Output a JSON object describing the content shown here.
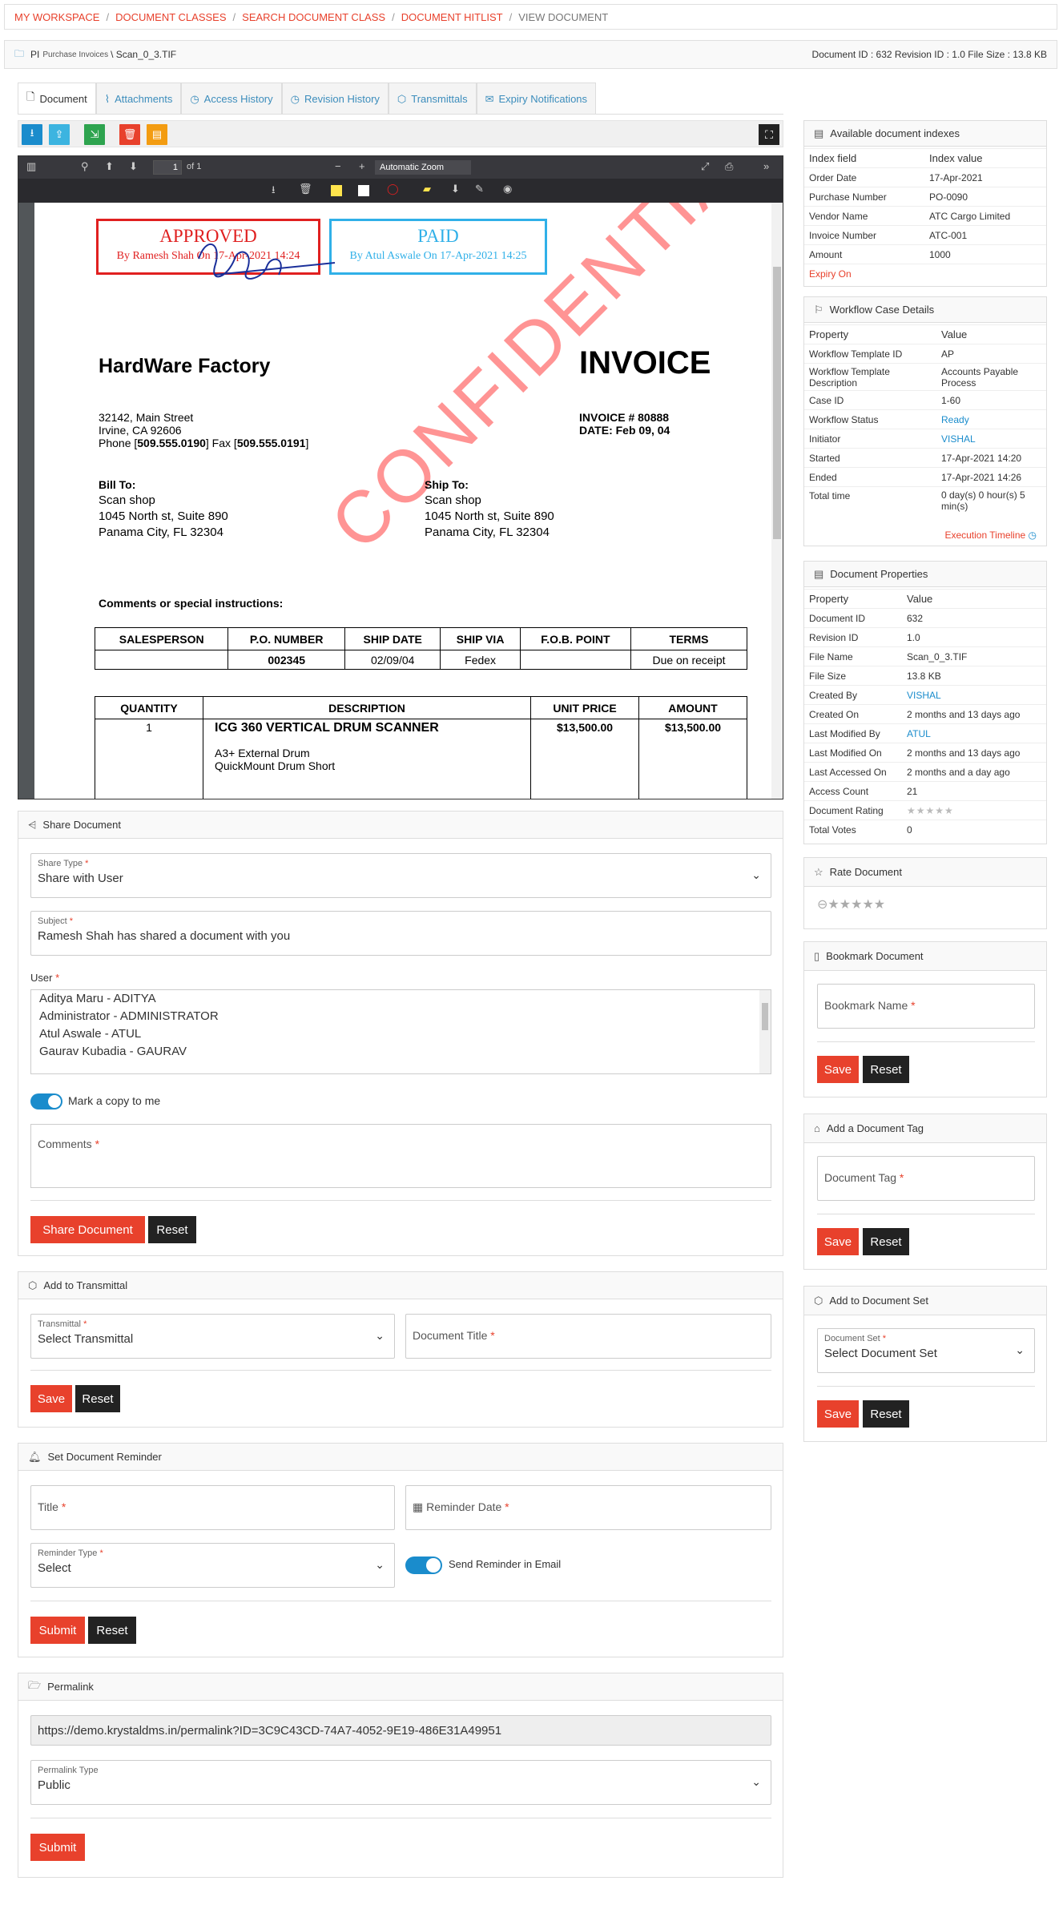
{
  "breadcrumb": {
    "items": [
      "MY WORKSPACE",
      "DOCUMENT CLASSES",
      "SEARCH DOCUMENT CLASS",
      "DOCUMENT HITLIST"
    ],
    "current": "VIEW DOCUMENT"
  },
  "docbar": {
    "class_code": "PI",
    "class_name": "Purchase Invoices",
    "file": "\\ Scan_0_3.TIF",
    "info": "Document ID : 632  Revision ID : 1.0  File Size : 13.8 KB"
  },
  "tabs": [
    {
      "label": "Document",
      "icon": "file-icon"
    },
    {
      "label": "Attachments",
      "icon": "paperclip-icon"
    },
    {
      "label": "Access History",
      "icon": "clock-icon"
    },
    {
      "label": "Revision History",
      "icon": "clock-icon"
    },
    {
      "label": "Transmittals",
      "icon": "cube-icon"
    },
    {
      "label": "Expiry Notifications",
      "icon": "envelope-icon"
    }
  ],
  "toolbar": {
    "colors": [
      "#1a8ccc",
      "#3cb4e0",
      "#2ea44f",
      "#e8412c",
      "#f39c12"
    ]
  },
  "viewer": {
    "page_num": "1",
    "page_total": "of 1",
    "zoom": "Automatic Zoom"
  },
  "invoice": {
    "stamp1_title": "APPROVED",
    "stamp1_sub": "By Ramesh Shah On 17-Apr-2021 14:24",
    "stamp2_title": "PAID",
    "stamp2_sub": "By Atul Aswale On 17-Apr-2021 14:25",
    "watermark": "CONFIDENTIAL",
    "company": "HardWare Factory",
    "title": "INVOICE",
    "addr1": "32142, Main Street",
    "addr2": "Irvine, CA 92606",
    "phone_label": "Phone [",
    "phone": "509.555.0190",
    "fax_label": "]  Fax [",
    "fax": "509.555.0191",
    "close": "]",
    "invno": "INVOICE # 80888",
    "date": "DATE: Feb 09, 04",
    "bill_label": "Bill To:",
    "bill1": "Scan shop",
    "bill2": "1045 North st, Suite 890",
    "bill3": "Panama City, FL 32304",
    "ship_label": "Ship To:",
    "ship1": "Scan shop",
    "ship2": "1045 North st, Suite 890",
    "ship3": "Panama City, FL 32304",
    "comments": "Comments or special instructions:",
    "t1_heads": [
      "SALESPERSON",
      "P.O. NUMBER",
      "SHIP DATE",
      "SHIP VIA",
      "F.O.B. POINT",
      "TERMS"
    ],
    "t1_row": [
      "",
      "002345",
      "02/09/04",
      "Fedex",
      "",
      "Due on receipt"
    ],
    "t2_heads": [
      "QUANTITY",
      "DESCRIPTION",
      "UNIT PRICE",
      "AMOUNT"
    ],
    "t2_qty": "1",
    "t2_desc": "ICG 360 VERTICAL DRUM SCANNER",
    "t2_desc2": "A3+ External Drum",
    "t2_desc3": "QuickMount Drum Short",
    "t2_price": "$13,500.00",
    "t2_amount": "$13,500.00"
  },
  "share": {
    "title": "Share Document",
    "share_type_label": "Share Type",
    "share_type": "Share with User",
    "subject_label": "Subject",
    "subject": "Ramesh Shah has shared a document with you",
    "user_label": "User",
    "users": [
      "Aditya Maru - ADITYA",
      "Administrator - ADMINISTRATOR",
      "Atul Aswale - ATUL",
      "Gaurav Kubadia - GAURAV"
    ],
    "copy_label": "Mark a copy to me",
    "comments_label": "Comments",
    "submit": "Share Document",
    "reset": "Reset"
  },
  "transmittal": {
    "title": "Add to Transmittal",
    "select_label": "Transmittal",
    "select_value": "Select Transmittal",
    "doc_title_label": "Document Title",
    "save": "Save",
    "reset": "Reset"
  },
  "reminder": {
    "title": "Set Document Reminder",
    "title_label": "Title",
    "date_label": "Reminder Date",
    "type_label": "Reminder Type",
    "type_value": "Select",
    "email_label": "Send Reminder in Email",
    "submit": "Submit",
    "reset": "Reset"
  },
  "permalink": {
    "title": "Permalink",
    "url": "https://demo.krystaldms.in/permalink?ID=3C9C43CD-74A7-4052-9E19-486E31A49951",
    "type_label": "Permalink Type",
    "type_value": "Public",
    "submit": "Submit"
  },
  "indexes": {
    "title": "Available document indexes",
    "h1": "Index field",
    "h2": "Index value",
    "rows": [
      [
        "Order Date",
        "17-Apr-2021"
      ],
      [
        "Purchase Number",
        "PO-0090"
      ],
      [
        "Vendor Name",
        "ATC Cargo Limited"
      ],
      [
        "Invoice Number",
        "ATC-001"
      ],
      [
        "Amount",
        "1000"
      ]
    ],
    "expiry": "Expiry On"
  },
  "workflow": {
    "title": "Workflow Case Details",
    "h1": "Property",
    "h2": "Value",
    "rows": [
      [
        "Workflow Template ID",
        "AP"
      ],
      [
        "Workflow Template Description",
        "Accounts Payable Process"
      ],
      [
        "Case ID",
        "1-60"
      ],
      [
        "Workflow Status",
        "Ready"
      ],
      [
        "Initiator",
        "VISHAL"
      ],
      [
        "Started",
        "17-Apr-2021 14:20"
      ],
      [
        "Ended",
        "17-Apr-2021 14:26"
      ],
      [
        "Total time",
        "0 day(s) 0 hour(s) 5 min(s)"
      ]
    ],
    "timeline": "Execution Timeline"
  },
  "props": {
    "title": "Document Properties",
    "h1": "Property",
    "h2": "Value",
    "rows": [
      [
        "Document ID",
        "632"
      ],
      [
        "Revision ID",
        "1.0"
      ],
      [
        "File Name",
        "Scan_0_3.TIF"
      ],
      [
        "File Size",
        "13.8 KB"
      ],
      [
        "Created By",
        "VISHAL"
      ],
      [
        "Created On",
        "2 months and 13 days ago"
      ],
      [
        "Last Modified By",
        "ATUL"
      ],
      [
        "Last Modified On",
        "2 months and 13 days ago"
      ],
      [
        "Last Accessed On",
        "2 months and a day ago"
      ],
      [
        "Access Count",
        "21"
      ],
      [
        "Document Rating",
        ""
      ],
      [
        "Total Votes",
        "0"
      ]
    ]
  },
  "rate": {
    "title": "Rate Document"
  },
  "bookmark": {
    "title": "Bookmark Document",
    "label": "Bookmark Name",
    "save": "Save",
    "reset": "Reset"
  },
  "tag": {
    "title": "Add a Document Tag",
    "label": "Document Tag",
    "save": "Save",
    "reset": "Reset"
  },
  "docset": {
    "title": "Add to Document Set",
    "label": "Document Set",
    "value": "Select Document Set",
    "save": "Save",
    "reset": "Reset"
  }
}
